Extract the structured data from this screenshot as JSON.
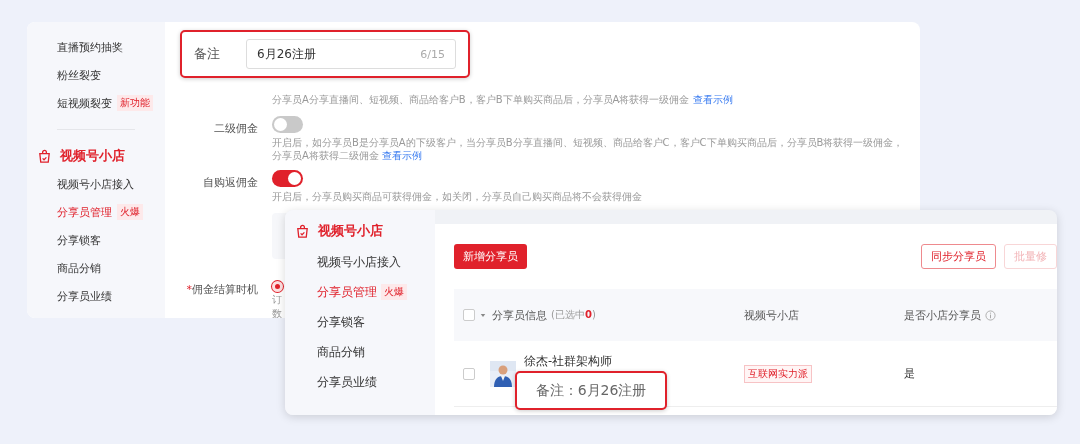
{
  "back_panel": {
    "sidebar": {
      "groups": [
        {
          "items": [
            {
              "label": "直播预约抽奖",
              "selected": false
            },
            {
              "label": "粉丝裂变",
              "selected": false
            },
            {
              "label": "短视频裂变",
              "badge": "新功能",
              "selected": false
            }
          ]
        },
        {
          "title": "视频号小店",
          "items": [
            {
              "label": "视频号小店接入",
              "selected": false
            },
            {
              "label": "分享员管理",
              "badge": "火爆",
              "selected": true
            },
            {
              "label": "分享锁客",
              "selected": false
            },
            {
              "label": "商品分销",
              "selected": false
            },
            {
              "label": "分享员业绩",
              "selected": false
            }
          ]
        }
      ]
    },
    "settings": [
      {
        "kind": "hint",
        "hint": "分享员A分享直播间、短视频、商品给客户B，客户B下单购买商品后，分享员A将获得一级佣金",
        "link": "查看示例"
      },
      {
        "kind": "toggle",
        "label": "二级佣金",
        "on": false,
        "hint": "开启后，如分享员B是分享员A的下级客户，当分享员B分享直播间、短视频、商品给客户C，客户C下单购买商品后，分享员B将获得一级佣金，分享员A将获得二级佣金",
        "link": "查看示例"
      },
      {
        "kind": "toggle",
        "label": "自购返佣金",
        "on": true,
        "hint": "开启后，分享员购买商品可获得佣金，如关闭，分享员自己购买商品将不会获得佣金"
      },
      {
        "kind": "panel"
      },
      {
        "kind": "radio",
        "label": "佣金结算时机",
        "required_mark": "*",
        "selected": true,
        "hint_lines": [
          "订",
          "数"
        ]
      }
    ]
  },
  "note_callout": {
    "label": "备注",
    "value": "6月26注册",
    "counter": "6/15"
  },
  "front_panel": {
    "sidebar": {
      "title": "视频号小店",
      "items": [
        {
          "label": "视频号小店接入",
          "selected": false
        },
        {
          "label": "分享员管理",
          "badge": "火爆",
          "selected": true
        },
        {
          "label": "分享锁客",
          "selected": false
        },
        {
          "label": "商品分销",
          "selected": false
        },
        {
          "label": "分享员业绩",
          "selected": false
        }
      ]
    },
    "buttons": [
      {
        "label": "新增分享员",
        "kind": "primary",
        "disabled": false
      },
      {
        "label": "同步分享员",
        "kind": "outline",
        "disabled": false
      },
      {
        "label": "批量修",
        "kind": "outline",
        "disabled": true
      }
    ],
    "table": {
      "select_all": {
        "checked": false
      },
      "columns": [
        {
          "label": "分享员信息",
          "selection_prefix": "(已选中",
          "selection_count": "0",
          "selection_suffix": ")"
        },
        {
          "label": "视频号小店"
        },
        {
          "label": "是否小店分享员",
          "has_info": true
        }
      ],
      "rows": [
        {
          "checked": false,
          "name": "徐杰-社群架构师",
          "shop_tag": "互联网实力派",
          "is_shop_sharer": "是"
        }
      ]
    }
  },
  "row_callout": {
    "text": "备注：6月26注册"
  }
}
